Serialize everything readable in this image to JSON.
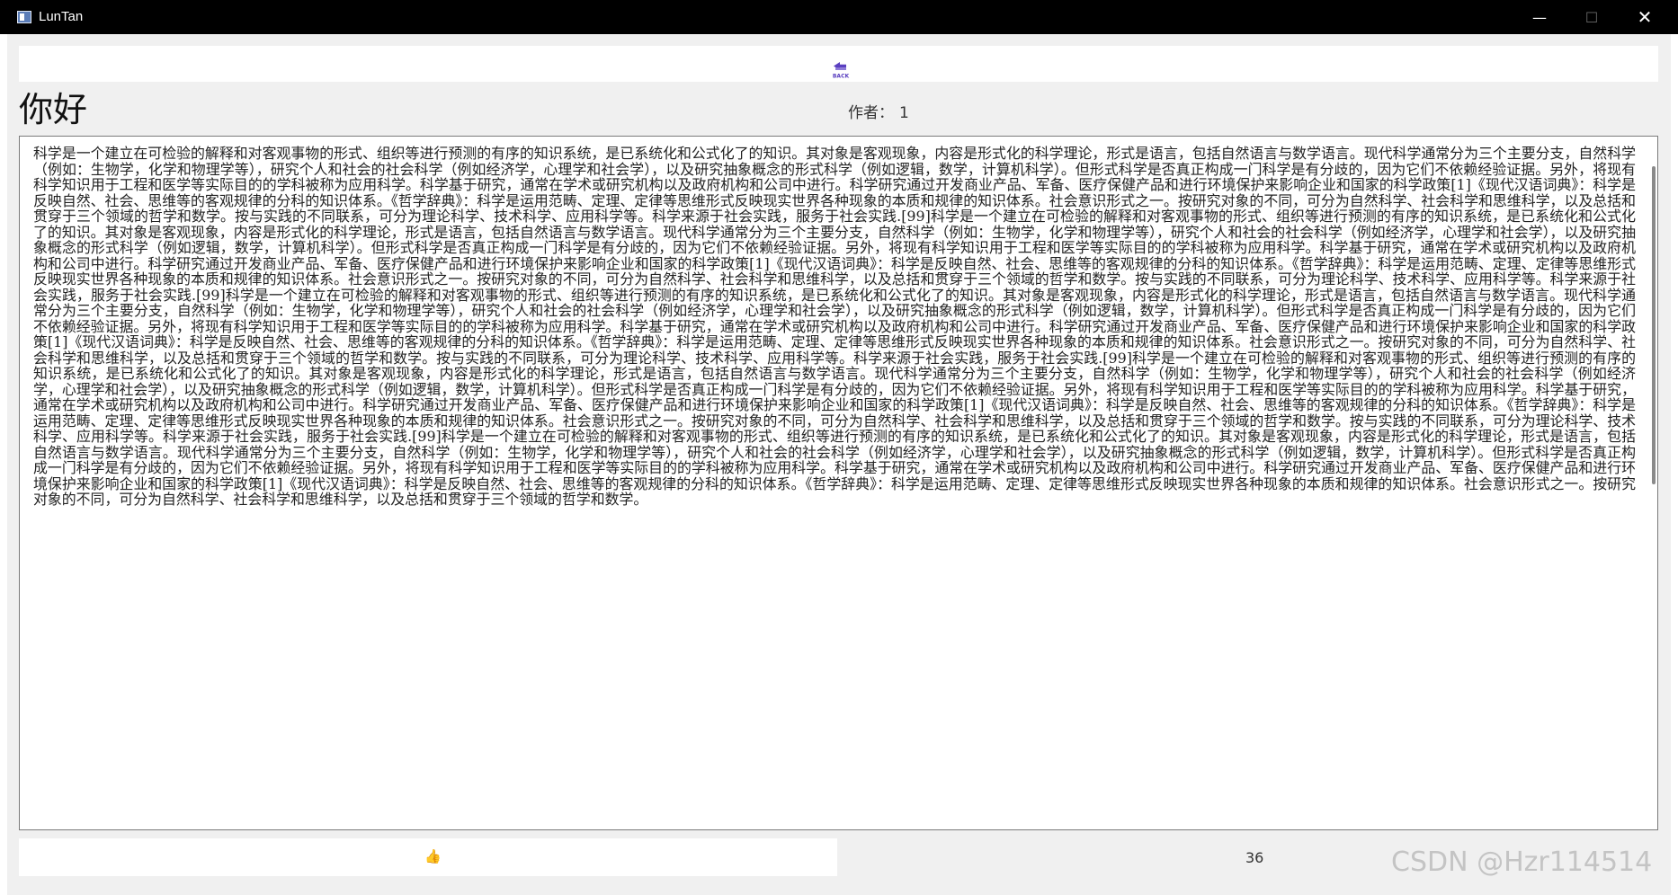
{
  "window": {
    "title": "LunTan",
    "icon": "app-window-icon",
    "controls": {
      "minimize": "—",
      "maximize": "☐",
      "close": "✕"
    }
  },
  "toolbar": {
    "back_icon": "back-arrow-icon",
    "back_text": "BACK"
  },
  "post": {
    "title": "你好",
    "author_label": "作者：",
    "author_value": "1",
    "content": "科学是一个建立在可检验的解释和对客观事物的形式、组织等进行预测的有序的知识系统，是已系统化和公式化了的知识。其对象是客观现象，内容是形式化的科学理论，形式是语言，包括自然语言与数学语言。现代科学通常分为三个主要分支，自然科学（例如：生物学，化学和物理学等），研究个人和社会的社会科学（例如经济学，心理学和社会学），以及研究抽象概念的形式科学（例如逻辑，数学，计算机科学）。但形式科学是否真正构成一门科学是有分歧的，因为它们不依赖经验证据。另外，将现有科学知识用于工程和医学等实际目的的学科被称为应用科学。科学基于研究，通常在学术或研究机构以及政府机构和公司中进行。科学研究通过开发商业产品、军备、医疗保健产品和进行环境保护来影响企业和国家的科学政策[1]《现代汉语词典》：科学是反映自然、社会、思维等的客观规律的分科的知识体系。《哲学辞典》：科学是运用范畴、定理、定律等思维形式反映现实世界各种现象的本质和规律的知识体系。社会意识形式之一。按研究对象的不同，可分为自然科学、社会科学和思维科学，以及总括和贯穿于三个领域的哲学和数学。按与实践的不同联系，可分为理论科学、技术科学、应用科学等。科学来源于社会实践，服务于社会实践.[99]科学是一个建立在可检验的解释和对客观事物的形式、组织等进行预测的有序的知识系统，是已系统化和公式化了的知识。其对象是客观现象，内容是形式化的科学理论，形式是语言，包括自然语言与数学语言。现代科学通常分为三个主要分支，自然科学（例如：生物学，化学和物理学等），研究个人和社会的社会科学（例如经济学，心理学和社会学），以及研究抽象概念的形式科学（例如逻辑，数学，计算机科学）。但形式科学是否真正构成一门科学是有分歧的，因为它们不依赖经验证据。另外，将现有科学知识用于工程和医学等实际目的的学科被称为应用科学。科学基于研究，通常在学术或研究机构以及政府机构和公司中进行。科学研究通过开发商业产品、军备、医疗保健产品和进行环境保护来影响企业和国家的科学政策[1]《现代汉语词典》：科学是反映自然、社会、思维等的客观规律的分科的知识体系。《哲学辞典》：科学是运用范畴、定理、定律等思维形式反映现实世界各种现象的本质和规律的知识体系。社会意识形式之一。按研究对象的不同，可分为自然科学、社会科学和思维科学，以及总括和贯穿于三个领域的哲学和数学。按与实践的不同联系，可分为理论科学、技术科学、应用科学等。科学来源于社会实践，服务于社会实践.[99]科学是一个建立在可检验的解释和对客观事物的形式、组织等进行预测的有序的知识系统，是已系统化和公式化了的知识。其对象是客观现象，内容是形式化的科学理论，形式是语言，包括自然语言与数学语言。现代科学通常分为三个主要分支，自然科学（例如：生物学，化学和物理学等），研究个人和社会的社会科学（例如经济学，心理学和社会学），以及研究抽象概念的形式科学（例如逻辑，数学，计算机科学）。但形式科学是否真正构成一门科学是有分歧的，因为它们不依赖经验证据。另外，将现有科学知识用于工程和医学等实际目的的学科被称为应用科学。科学基于研究，通常在学术或研究机构以及政府机构和公司中进行。科学研究通过开发商业产品、军备、医疗保健产品和进行环境保护来影响企业和国家的科学政策[1]《现代汉语词典》：科学是反映自然、社会、思维等的客观规律的分科的知识体系。《哲学辞典》：科学是运用范畴、定理、定律等思维形式反映现实世界各种现象的本质和规律的知识体系。社会意识形式之一。按研究对象的不同，可分为自然科学、社会科学和思维科学，以及总括和贯穿于三个领域的哲学和数学。按与实践的不同联系，可分为理论科学、技术科学、应用科学等。科学来源于社会实践，服务于社会实践.[99]科学是一个建立在可检验的解释和对客观事物的形式、组织等进行预测的有序的知识系统，是已系统化和公式化了的知识。其对象是客观现象，内容是形式化的科学理论，形式是语言，包括自然语言与数学语言。现代科学通常分为三个主要分支，自然科学（例如：生物学，化学和物理学等），研究个人和社会的社会科学（例如经济学，心理学和社会学），以及研究抽象概念的形式科学（例如逻辑，数学，计算机科学）。但形式科学是否真正构成一门科学是有分歧的，因为它们不依赖经验证据。另外，将现有科学知识用于工程和医学等实际目的的学科被称为应用科学。科学基于研究，通常在学术或研究机构以及政府机构和公司中进行。科学研究通过开发商业产品、军备、医疗保健产品和进行环境保护来影响企业和国家的科学政策[1]《现代汉语词典》：科学是反映自然、社会、思维等的客观规律的分科的知识体系。《哲学辞典》：科学是运用范畴、定理、定律等思维形式反映现实世界各种现象的本质和规律的知识体系。社会意识形式之一。按研究对象的不同，可分为自然科学、社会科学和思维科学，以及总括和贯穿于三个领域的哲学和数学。按与实践的不同联系，可分为理论科学、技术科学、应用科学等。科学来源于社会实践，服务于社会实践.[99]科学是一个建立在可检验的解释和对客观事物的形式、组织等进行预测的有序的知识系统，是已系统化和公式化了的知识。其对象是客观现象，内容是形式化的科学理论，形式是语言，包括自然语言与数学语言。现代科学通常分为三个主要分支，自然科学（例如：生物学，化学和物理学等），研究个人和社会的社会科学（例如经济学，心理学和社会学），以及研究抽象概念的形式科学（例如逻辑，数学，计算机科学）。但形式科学是否真正构成一门科学是有分歧的，因为它们不依赖经验证据。另外，将现有科学知识用于工程和医学等实际目的的学科被称为应用科学。科学基于研究，通常在学术或研究机构以及政府机构和公司中进行。科学研究通过开发商业产品、军备、医疗保健产品和进行环境保护来影响企业和国家的科学政策[1]《现代汉语词典》：科学是反映自然、社会、思维等的客观规律的分科的知识体系。《哲学辞典》：科学是运用范畴、定理、定律等思维形式反映现实世界各种现象的本质和规律的知识体系。社会意识形式之一。按研究对象的不同，可分为自然科学、社会科学和思维科学，以及总括和贯穿于三个领域的哲学和数学。"
  },
  "footer": {
    "like_icon": "👍",
    "like_count": "36"
  },
  "watermark": "CSDN @Hzr114514",
  "colors": {
    "titlebar": "#000000",
    "client_background": "#f0f0f0",
    "back_icon": "#5a3fc0",
    "like_icon": "#e5a020"
  }
}
